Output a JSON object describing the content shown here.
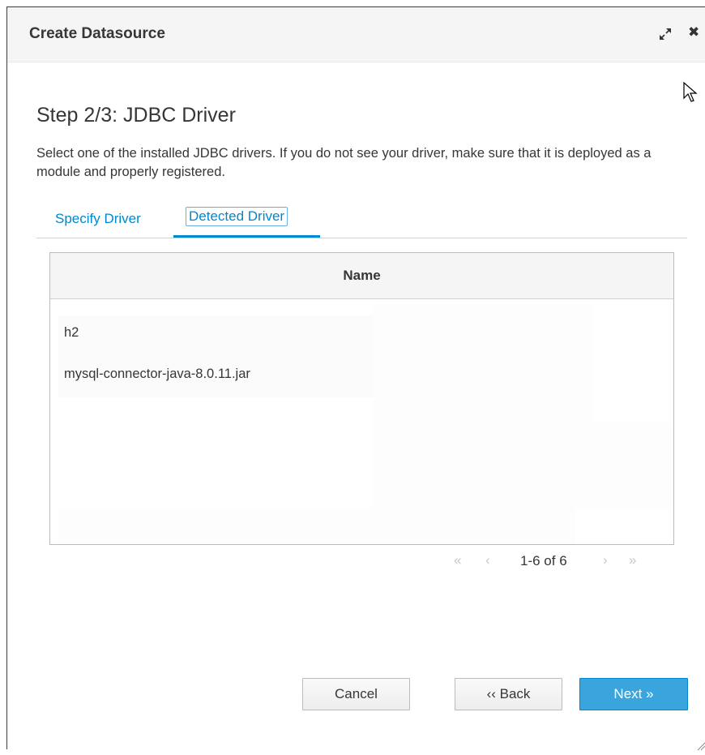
{
  "dialog": {
    "title": "Create Datasource",
    "icons": [
      "maximize-icon",
      "close-icon"
    ]
  },
  "step": {
    "title": "Step 2/3: JDBC Driver",
    "description": "Select one of the installed JDBC drivers. If you do not see your driver, make sure that it is deployed as a module and properly registered."
  },
  "tabs": [
    {
      "label": "Specify Driver",
      "active": false
    },
    {
      "label": "Detected Driver",
      "active": true
    }
  ],
  "table": {
    "column_header": "Name",
    "rows": [
      "h2",
      "mysql-connector-java-8.0.11.jar"
    ]
  },
  "pagination": {
    "first": "«",
    "prev": "‹",
    "text": "1-6 of 6",
    "next": "›",
    "last": "»"
  },
  "buttons": {
    "cancel": "Cancel",
    "back": "‹‹ Back",
    "next": "Next »"
  },
  "colors": {
    "accent": "#0088ce",
    "primary_button": "#39a5dc"
  }
}
